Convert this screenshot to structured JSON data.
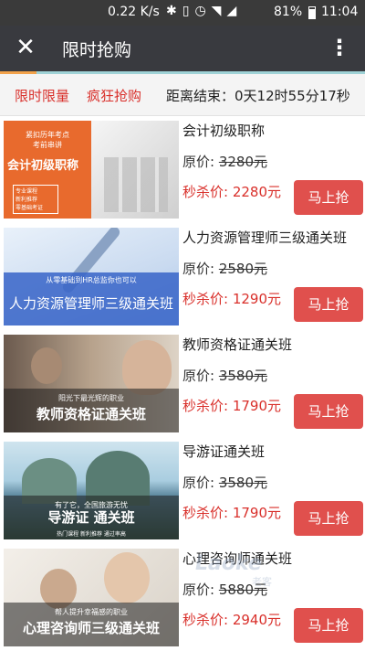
{
  "status_bar": {
    "speed": "0.22 K/s",
    "battery": "81%",
    "time": "11:04",
    "icons": [
      "bluetooth-icon",
      "vibrate-icon",
      "alarm-icon",
      "wifi-icon",
      "signal-icon",
      "battery-icon"
    ]
  },
  "header": {
    "title": "限时抢购",
    "close_icon": "close-icon",
    "more_icon": "more-vert-icon"
  },
  "tabs": {
    "limited": "限时限量",
    "crazy": "疯狂抢购",
    "countdown": "距离结束：0天12时55分17秒"
  },
  "labels": {
    "orig_prefix": "原价:",
    "sale_prefix": "秒杀价:",
    "buy": "马上抢"
  },
  "items": [
    {
      "name": "会计初级职称",
      "orig_price": "3280元",
      "sale_price": "2280元",
      "thumb_title": "会计初级职称",
      "thumb_top": "紧扣历年考点\n考前串讲",
      "thumb_box": "专业课程\n新利推荐\n零基础考证"
    },
    {
      "name": "人力资源管理师三级通关班",
      "orig_price": "2580元",
      "sale_price": "1290元",
      "thumb_title": "人力资源管理师三级通关班",
      "thumb_sub": "从零基础到HR总监你也可以"
    },
    {
      "name": "教师资格证通关班",
      "orig_price": "3580元",
      "sale_price": "1790元",
      "thumb_title": "教师资格证通关班",
      "thumb_sub": "阳光下最光辉的职业"
    },
    {
      "name": "导游证通关班",
      "orig_price": "3580元",
      "sale_price": "1790元",
      "thumb_title": "导游证 通关班",
      "thumb_sub": "有了它，全国旅游无忧",
      "thumb_mini": "热门课程 新利推荐 通过率高"
    },
    {
      "name": "心理咨询师通关班",
      "orig_price": "5880元",
      "sale_price": "2940元",
      "thumb_title": "心理咨询师三级通关班",
      "thumb_sub": "帮人提升幸福感的职业"
    }
  ],
  "watermark": {
    "brand": "Laoke",
    "sub": "老客"
  },
  "colors": {
    "accent_red": "#d9302b",
    "button_red": "#e0504d",
    "appbar": "#393a3f"
  }
}
